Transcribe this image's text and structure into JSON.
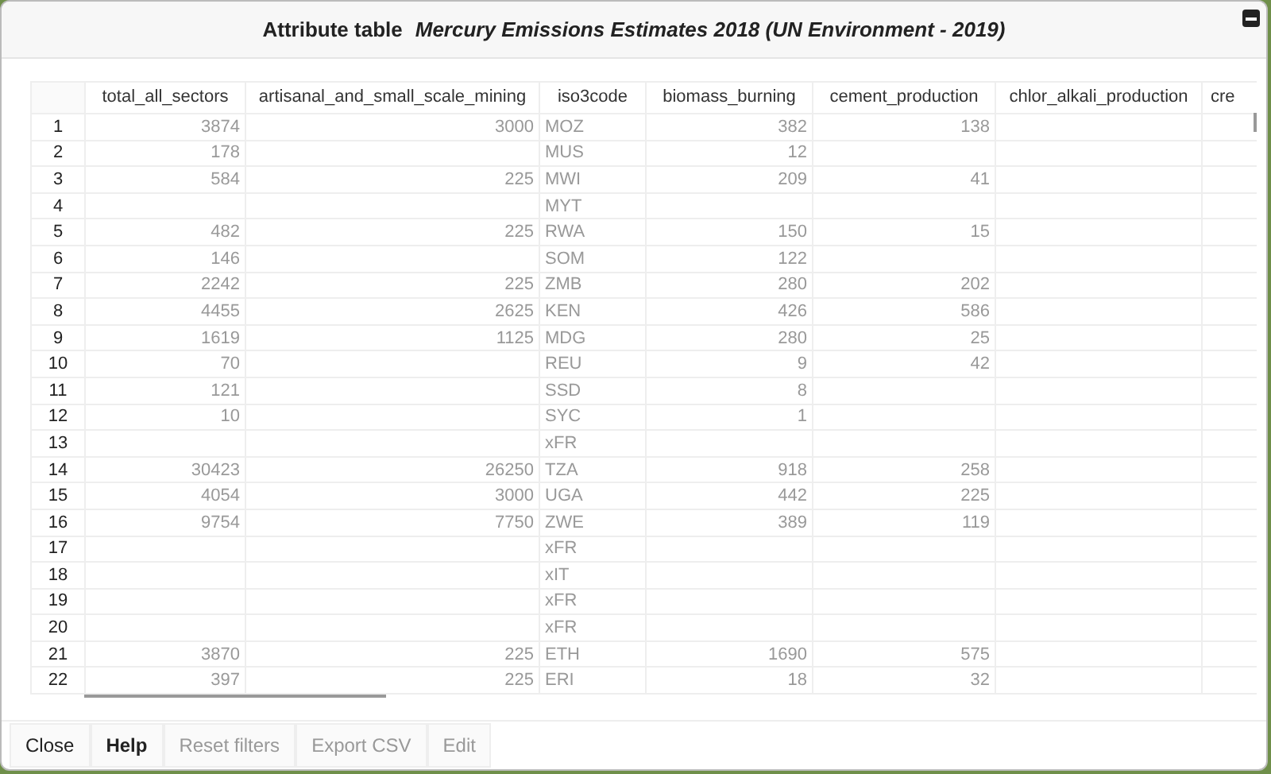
{
  "dialog": {
    "title": "Attribute table",
    "layer": "Mercury Emissions Estimates 2018 (UN Environment - 2019)"
  },
  "table": {
    "columns": [
      "total_all_sectors",
      "artisanal_and_small_scale_mining",
      "iso3code",
      "biomass_burning",
      "cement_production",
      "chlor_alkali_production",
      "cre"
    ],
    "rows": [
      {
        "index": "1",
        "cells": [
          "3874",
          "3000",
          "MOZ",
          "382",
          "138",
          null
        ]
      },
      {
        "index": "2",
        "cells": [
          "178",
          null,
          "MUS",
          "12",
          null,
          null
        ]
      },
      {
        "index": "3",
        "cells": [
          "584",
          "225",
          "MWI",
          "209",
          "41",
          null
        ]
      },
      {
        "index": "4",
        "cells": [
          null,
          null,
          "MYT",
          null,
          null,
          null
        ]
      },
      {
        "index": "5",
        "cells": [
          "482",
          "225",
          "RWA",
          "150",
          "15",
          null
        ]
      },
      {
        "index": "6",
        "cells": [
          "146",
          null,
          "SOM",
          "122",
          null,
          null
        ]
      },
      {
        "index": "7",
        "cells": [
          "2242",
          "225",
          "ZMB",
          "280",
          "202",
          null
        ]
      },
      {
        "index": "8",
        "cells": [
          "4455",
          "2625",
          "KEN",
          "426",
          "586",
          null
        ]
      },
      {
        "index": "9",
        "cells": [
          "1619",
          "1125",
          "MDG",
          "280",
          "25",
          null
        ]
      },
      {
        "index": "10",
        "cells": [
          "70",
          null,
          "REU",
          "9",
          "42",
          null
        ]
      },
      {
        "index": "11",
        "cells": [
          "121",
          null,
          "SSD",
          "8",
          null,
          null
        ]
      },
      {
        "index": "12",
        "cells": [
          "10",
          null,
          "SYC",
          "1",
          null,
          null
        ]
      },
      {
        "index": "13",
        "cells": [
          null,
          null,
          "xFR",
          null,
          null,
          null
        ]
      },
      {
        "index": "14",
        "cells": [
          "30423",
          "26250",
          "TZA",
          "918",
          "258",
          null
        ]
      },
      {
        "index": "15",
        "cells": [
          "4054",
          "3000",
          "UGA",
          "442",
          "225",
          null
        ]
      },
      {
        "index": "16",
        "cells": [
          "9754",
          "7750",
          "ZWE",
          "389",
          "119",
          null
        ]
      },
      {
        "index": "17",
        "cells": [
          null,
          null,
          "xFR",
          null,
          null,
          null
        ]
      },
      {
        "index": "18",
        "cells": [
          null,
          null,
          "xIT",
          null,
          null,
          null
        ]
      },
      {
        "index": "19",
        "cells": [
          null,
          null,
          "xFR",
          null,
          null,
          null
        ]
      },
      {
        "index": "20",
        "cells": [
          null,
          null,
          "xFR",
          null,
          null,
          null
        ]
      },
      {
        "index": "21",
        "cells": [
          "3870",
          "225",
          "ETH",
          "1690",
          "575",
          null
        ]
      },
      {
        "index": "22",
        "cells": [
          "397",
          "225",
          "ERI",
          "18",
          "32",
          null
        ]
      }
    ]
  },
  "buttons": [
    {
      "label": "Close",
      "disabled": false
    },
    {
      "label": "Help",
      "disabled": false
    },
    {
      "label": "Reset filters",
      "disabled": true
    },
    {
      "label": "Export CSV",
      "disabled": true
    },
    {
      "label": "Edit",
      "disabled": true
    }
  ]
}
